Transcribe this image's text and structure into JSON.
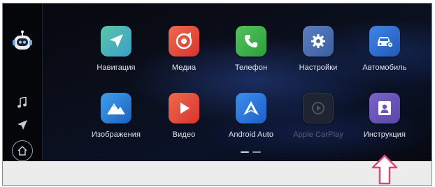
{
  "sidebar": {
    "items": [
      {
        "name": "assistant",
        "icon": "robot-assistant-icon"
      },
      {
        "name": "music",
        "icon": "music-note-icon"
      },
      {
        "name": "navigation",
        "icon": "navigation-arrow-icon"
      },
      {
        "name": "home",
        "icon": "home-icon"
      }
    ]
  },
  "apps": [
    {
      "label": "Навигация",
      "icon": "navigation-icon",
      "color": "#46b6a8",
      "enabled": true
    },
    {
      "label": "Медиа",
      "icon": "media-icon",
      "color": "#e8483c",
      "enabled": true
    },
    {
      "label": "Телефон",
      "icon": "phone-icon",
      "color": "#3fb44a",
      "enabled": true
    },
    {
      "label": "Настройки",
      "icon": "settings-gear-icon",
      "color": "#4a6fb0",
      "enabled": true
    },
    {
      "label": "Автомобиль",
      "icon": "car-settings-icon",
      "color": "#2f6fd0",
      "enabled": true
    },
    {
      "label": "Изображения",
      "icon": "images-icon",
      "color": "#2f8fe0",
      "enabled": true
    },
    {
      "label": "Видео",
      "icon": "video-play-icon",
      "color": "#e8483c",
      "enabled": true
    },
    {
      "label": "Android Auto",
      "icon": "android-auto-icon",
      "color": "#2a7fe0",
      "enabled": true
    },
    {
      "label": "Apple CarPlay",
      "icon": "carplay-icon",
      "color": "#2a3340",
      "enabled": false
    },
    {
      "label": "Инструкция",
      "icon": "manual-icon",
      "color": "#6a55b8",
      "enabled": true
    }
  ],
  "pagination": {
    "pages": 2,
    "current": 1
  },
  "callout": {
    "icon": "up-arrow-callout-icon",
    "color": "#e0457a"
  }
}
